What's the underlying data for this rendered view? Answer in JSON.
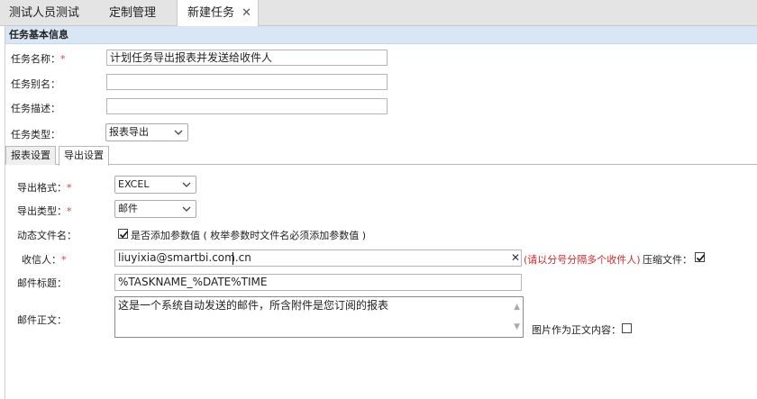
{
  "tabs": [
    {
      "label": "测试人员测试"
    },
    {
      "label": "定制管理"
    },
    {
      "label": "新建任务"
    }
  ],
  "section": {
    "title": "任务基本信息"
  },
  "form": {
    "name": {
      "label": "任务名称：",
      "required": "*",
      "value": "计划任务导出报表并发送给收件人"
    },
    "alias": {
      "label": "任务别名：",
      "value": ""
    },
    "desc": {
      "label": "任务描述：",
      "value": ""
    },
    "type": {
      "label": "任务类型：",
      "selected": "报表导出"
    }
  },
  "subtabs": [
    {
      "label": "报表设置"
    },
    {
      "label": "导出设置"
    }
  ],
  "export": {
    "format": {
      "label": "导出格式：",
      "required": "*",
      "selected": "EXCEL"
    },
    "kind": {
      "label": "导出类型：",
      "required": "*",
      "selected": "邮件"
    },
    "dynamic": {
      "label": "动态文件名：",
      "checked": true,
      "checkbox_label": "是否添加参数值 ( 枚举参数时文件名必须添加参数值 )"
    },
    "recipient": {
      "label": "收信人：",
      "required": "*",
      "value": "liuyixia@smartbi.com.cn",
      "hint": "(请以分号分隔多个收件人)",
      "compress_label": "压缩文件：",
      "compress_checked": true
    },
    "subject": {
      "label": "邮件标题：",
      "value": "%TASKNAME_%DATE%TIME"
    },
    "body": {
      "label": "邮件正文：",
      "value": "这是一个系统自动发送的邮件，所含附件是您订阅的报表"
    },
    "image_as_body": {
      "label": "图片作为正文内容：",
      "checked": false
    }
  },
  "colors": {
    "header_bg": "#d9e6f5",
    "required": "#e23b3b",
    "hint": "#d12b2b"
  }
}
